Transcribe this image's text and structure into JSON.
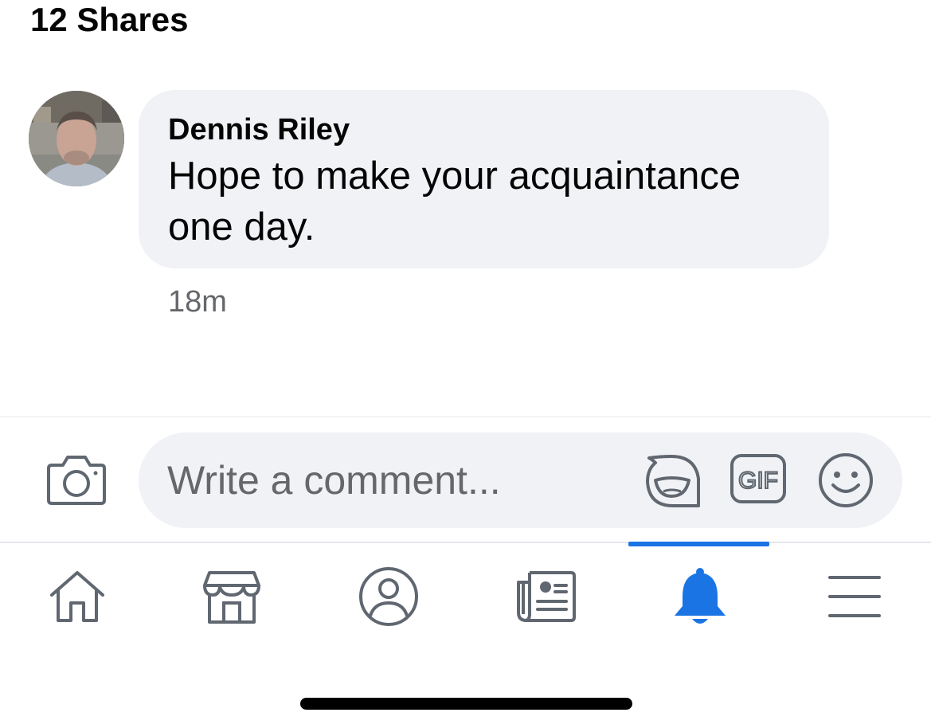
{
  "post": {
    "shares_label": "12 Shares"
  },
  "comment": {
    "author": "Dennis Riley",
    "text": "Hope to make your acquaintance one day.",
    "time": "18m"
  },
  "composer": {
    "placeholder": "Write a comment...",
    "gif_label": "GIF",
    "icons": [
      "camera-icon",
      "sticker-icon",
      "gif-icon",
      "emoji-icon"
    ]
  },
  "nav": {
    "items": [
      {
        "name": "home",
        "icon": "home-icon"
      },
      {
        "name": "marketplace",
        "icon": "marketplace-icon"
      },
      {
        "name": "profile",
        "icon": "profile-icon"
      },
      {
        "name": "news",
        "icon": "news-icon"
      },
      {
        "name": "notifications",
        "icon": "bell-icon",
        "active": true
      },
      {
        "name": "menu",
        "icon": "menu-icon"
      }
    ]
  },
  "colors": {
    "accent": "#1b74e4",
    "bubble": "#f0f2f5",
    "text": "#050505",
    "secondary_text": "#65676b",
    "icon": "#606770"
  }
}
